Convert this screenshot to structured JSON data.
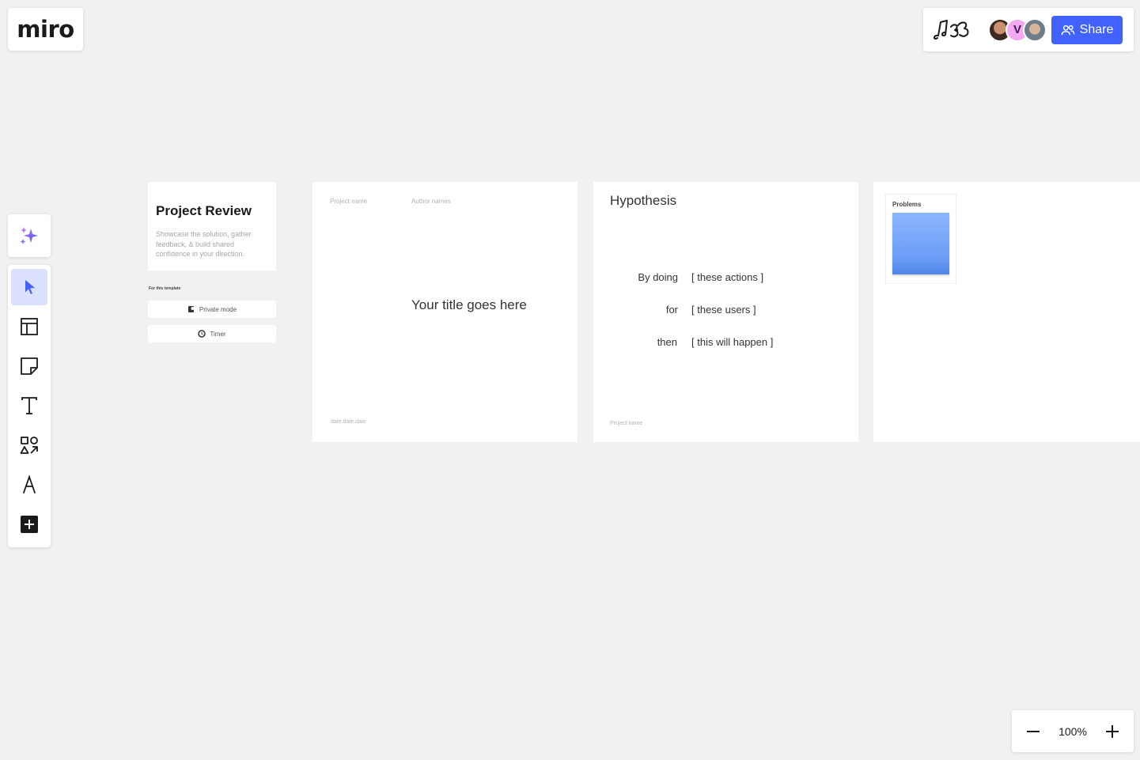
{
  "app": {
    "logo_text": "miro"
  },
  "header": {
    "board_icon": "music-notes-icon",
    "avatars": [
      {
        "kind": "photo",
        "name_icon": "avatar-photo-icon"
      },
      {
        "kind": "initial",
        "initial": "V",
        "color": "#f4a9f0"
      },
      {
        "kind": "photo",
        "name_icon": "avatar-photo-icon"
      }
    ],
    "share_label": "Share",
    "share_color": "#4262ff"
  },
  "toolbar": {
    "ai_icon": "sparkle-icon",
    "tools": [
      {
        "id": "select",
        "icon": "cursor-icon",
        "active": true
      },
      {
        "id": "templates",
        "icon": "layout-icon",
        "active": false
      },
      {
        "id": "sticky",
        "icon": "sticky-note-icon",
        "active": false
      },
      {
        "id": "text",
        "icon": "text-icon",
        "active": false
      },
      {
        "id": "shapes",
        "icon": "shapes-icon",
        "active": false
      },
      {
        "id": "pen",
        "icon": "pen-icon",
        "active": false
      },
      {
        "id": "more",
        "icon": "plus-square-icon",
        "active": false
      }
    ]
  },
  "zoom": {
    "value": "100%"
  },
  "board": {
    "review": {
      "title": "Project Review",
      "description": "Showcase the solution, gather feedback, & build shared confidence in your direction.",
      "template_label": "For this template",
      "buttons": [
        "Private mode",
        "Timer"
      ]
    },
    "title_frame": {
      "project_name": "Project name",
      "author_names": "Author names",
      "title": "Your title goes here",
      "date": "date.date.date"
    },
    "hypothesis": {
      "title": "Hypothesis",
      "rows": [
        {
          "label": "By doing",
          "value": "[ these actions ]"
        },
        {
          "label": "for",
          "value": "[ these users ]"
        },
        {
          "label": "then",
          "value": "[ this will happen ]"
        }
      ],
      "project_name": "Project name"
    },
    "problems": {
      "label": "Problems",
      "sticky_color": "#7aa8fa"
    }
  }
}
